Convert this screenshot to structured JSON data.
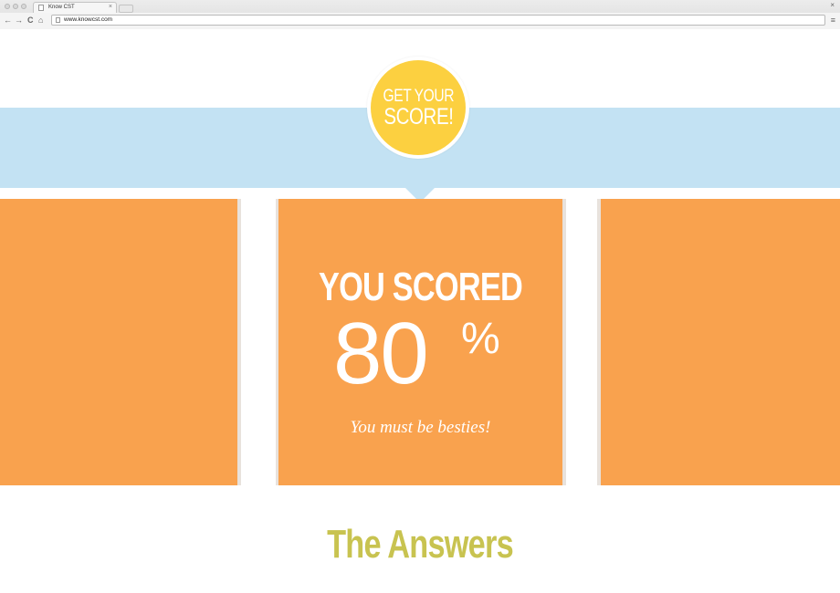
{
  "browser": {
    "tab_title": "Know CST",
    "tab_close": "×",
    "window_close": "×",
    "url": "www.knowcst.com",
    "back_icon": "←",
    "forward_icon": "→",
    "reload_icon": "C",
    "home_icon": "⌂",
    "menu_icon": "≡"
  },
  "badge": {
    "line1": "GET YOUR",
    "line2": "SCORE!"
  },
  "score": {
    "title": "YOU SCORED",
    "value": "80",
    "percent_sign": "%",
    "message": "You must be besties!"
  },
  "answers": {
    "heading": "The Answers"
  },
  "colors": {
    "band": "#c3e2f3",
    "badge": "#fcd040",
    "card": "#f9a24e",
    "heading": "#c8c350"
  }
}
